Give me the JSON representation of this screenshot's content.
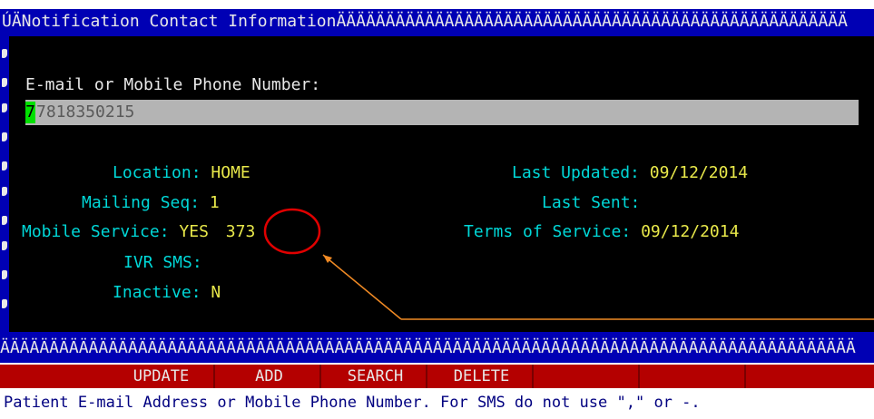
{
  "window": {
    "title": "ÚÄNotification Contact InformationÄÄÄÄÄÄÄÄÄÄÄÄÄÄÄÄÄÄÄÄÄÄÄÄÄÄÄÄÄÄÄÄÄÄÄÄÄÄÄÄÄÄÄÄÄÄÄÄÄÄÄÄ"
  },
  "contact": {
    "field_label": "E-mail or Mobile Phone Number:",
    "value": "7818350215",
    "cursor_char": "7",
    "value_rest": "818350215"
  },
  "details_left": {
    "location_label": "Location:",
    "location_value": "HOME",
    "mailing_seq_label": "Mailing Seq:",
    "mailing_seq_value": "1",
    "mobile_service_label": "Mobile Service:",
    "mobile_service_value": "YES",
    "mobile_service_code": "373",
    "ivr_sms_label": "IVR SMS:",
    "ivr_sms_value": "",
    "inactive_label": "Inactive:",
    "inactive_value": "N"
  },
  "details_right": {
    "last_updated_label": "Last Updated:",
    "last_updated_value": "09/12/2014",
    "last_sent_label": "Last Sent:",
    "last_sent_value": "",
    "terms_label": "Terms of Service:",
    "terms_value": "09/12/2014"
  },
  "separator": "ÄÄÄÄÄÄÄÄÄÄÄÄÄÄÄÄÄÄÄÄÄÄÄÄÄÄÄÄÄÄÄÄÄÄÄÄÄÄÄÄÄÄÄÄÄÄÄÄÄÄÄÄÄÄÄÄÄÄÄÄÄÄÄÄÄÄÄÄÄÄÄÄÄÄÄÄÄÄÄÄÄÄÄÄÄÄÄ",
  "menu": {
    "update": "UPDATE",
    "add": "ADD",
    "search": "SEARCH",
    "delete": "DELETE",
    "blank1": "",
    "blank2": "",
    "blank3": ""
  },
  "status_line": "Patient E-mail Address or Mobile Phone Number.  For SMS do not use \",\" or -.",
  "colors": {
    "window_blue": "#0000b4",
    "menu_red": "#b40000",
    "cursor_green": "#00e000",
    "annotation_red": "#e00000",
    "annotation_orange": "#f08a24"
  }
}
